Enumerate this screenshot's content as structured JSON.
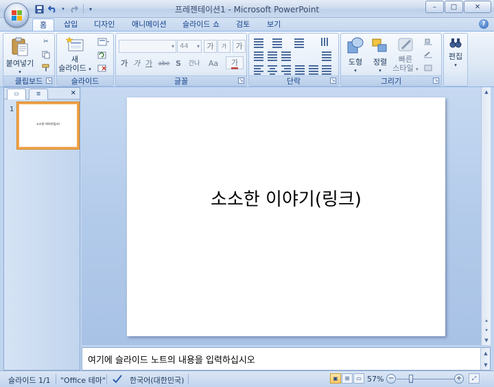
{
  "window": {
    "title": "프레젠테이션1 - Microsoft PowerPoint",
    "controls": {
      "minimize": "–",
      "maximize": "□",
      "close": "✕"
    }
  },
  "quick_access": {
    "save": "save-icon",
    "undo": "undo-icon",
    "redo": "redo-icon",
    "customize": "▾"
  },
  "tabs": [
    {
      "label": "홈",
      "active": true
    },
    {
      "label": "삽입"
    },
    {
      "label": "디자인"
    },
    {
      "label": "애니메이션"
    },
    {
      "label": "슬라이드 쇼"
    },
    {
      "label": "검토"
    },
    {
      "label": "보기"
    }
  ],
  "help": "?",
  "ribbon": {
    "clipboard": {
      "label": "클립보드",
      "paste": "붙여넣기",
      "paste_arrow": "▾"
    },
    "slides": {
      "label": "슬라이드",
      "new_slide_line1": "새",
      "new_slide_line2": "슬라이드",
      "new_slide_arrow": "▾"
    },
    "font": {
      "label": "글꼴",
      "font_name": "",
      "font_size": "44",
      "grow": "가",
      "shrink": "가",
      "clear": "가",
      "bold": "가",
      "italic": "가",
      "underline": "가",
      "strike": "abe",
      "shadow": "S",
      "spacing": "간나",
      "case": "Aa",
      "color": "가"
    },
    "paragraph": {
      "label": "단락"
    },
    "drawing": {
      "label": "그리기",
      "shapes": "도형",
      "arrange": "정렬",
      "quick_styles_line1": "빠른",
      "quick_styles_line2": "스타일"
    },
    "editing": {
      "label": "편집"
    }
  },
  "slide_pane": {
    "slide_number": "1",
    "thumb_text": "소소한 이야기(링크)",
    "close": "×"
  },
  "slide": {
    "title": "소소한 이야기(링크)"
  },
  "notes": {
    "placeholder": "여기에 슬라이드 노트의 내용을 입력하십시오"
  },
  "status": {
    "slide_info": "슬라이드 1/1",
    "theme": "\"Office 테마\"",
    "language": "한국어(대한민국)",
    "zoom": "57%",
    "zoom_minus": "−",
    "zoom_plus": "+"
  }
}
